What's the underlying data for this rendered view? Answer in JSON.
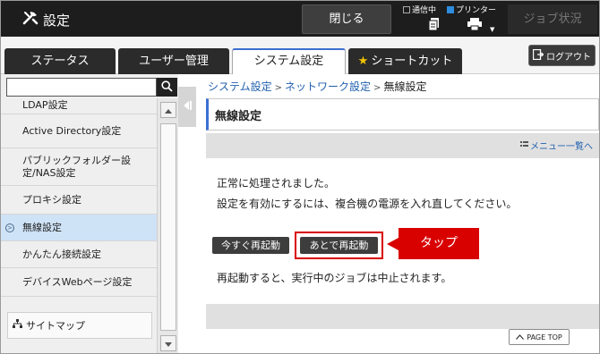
{
  "header": {
    "title": "設定",
    "close_label": "閉じる",
    "status_comm": "通信中",
    "status_printer": "プリンター",
    "job_status_label": "ジョブ状況"
  },
  "tabs": [
    {
      "label": "ステータス"
    },
    {
      "label": "ユーザー管理"
    },
    {
      "label": "システム設定"
    },
    {
      "label": "ショートカット"
    }
  ],
  "logout_label": "ログアウト",
  "search": {
    "value": ""
  },
  "sidebar": {
    "items": [
      {
        "label": "LDAP設定"
      },
      {
        "label": "Active Directory設定"
      },
      {
        "label": "パブリックフォルダー設定/NAS設定"
      },
      {
        "label": "プロキシ設定"
      },
      {
        "label": "無線設定"
      },
      {
        "label": "かんたん接続設定"
      },
      {
        "label": "デバイスWebページ設定"
      }
    ],
    "sitemap_label": "サイトマップ"
  },
  "breadcrumb": {
    "item1": "システム設定",
    "item2": "ネットワーク設定",
    "current": "無線設定",
    "sep": ">"
  },
  "main": {
    "page_title": "無線設定",
    "menu_list_link": "メニュー一覧へ",
    "message_1": "正常に処理されました。",
    "message_2": "設定を有効にするには、複合機の電源を入れ直してください。",
    "restart_now_label": "今すぐ再起動",
    "restart_later_label": "あとで再起動",
    "callout_label": "タップ",
    "warning_message": "再起動すると、実行中のジョブは中止されます。",
    "page_top_label": "PAGE TOP"
  },
  "colors": {
    "accent": "#3b6fd1",
    "highlight": "#d90000",
    "selected_item": "#cfe3f7",
    "header_bg": "#1d1d1d"
  },
  "icons": [
    "tools-icon",
    "search-icon",
    "logout-icon",
    "star-icon",
    "sitemap-icon",
    "printer-icon",
    "document-icon"
  ]
}
